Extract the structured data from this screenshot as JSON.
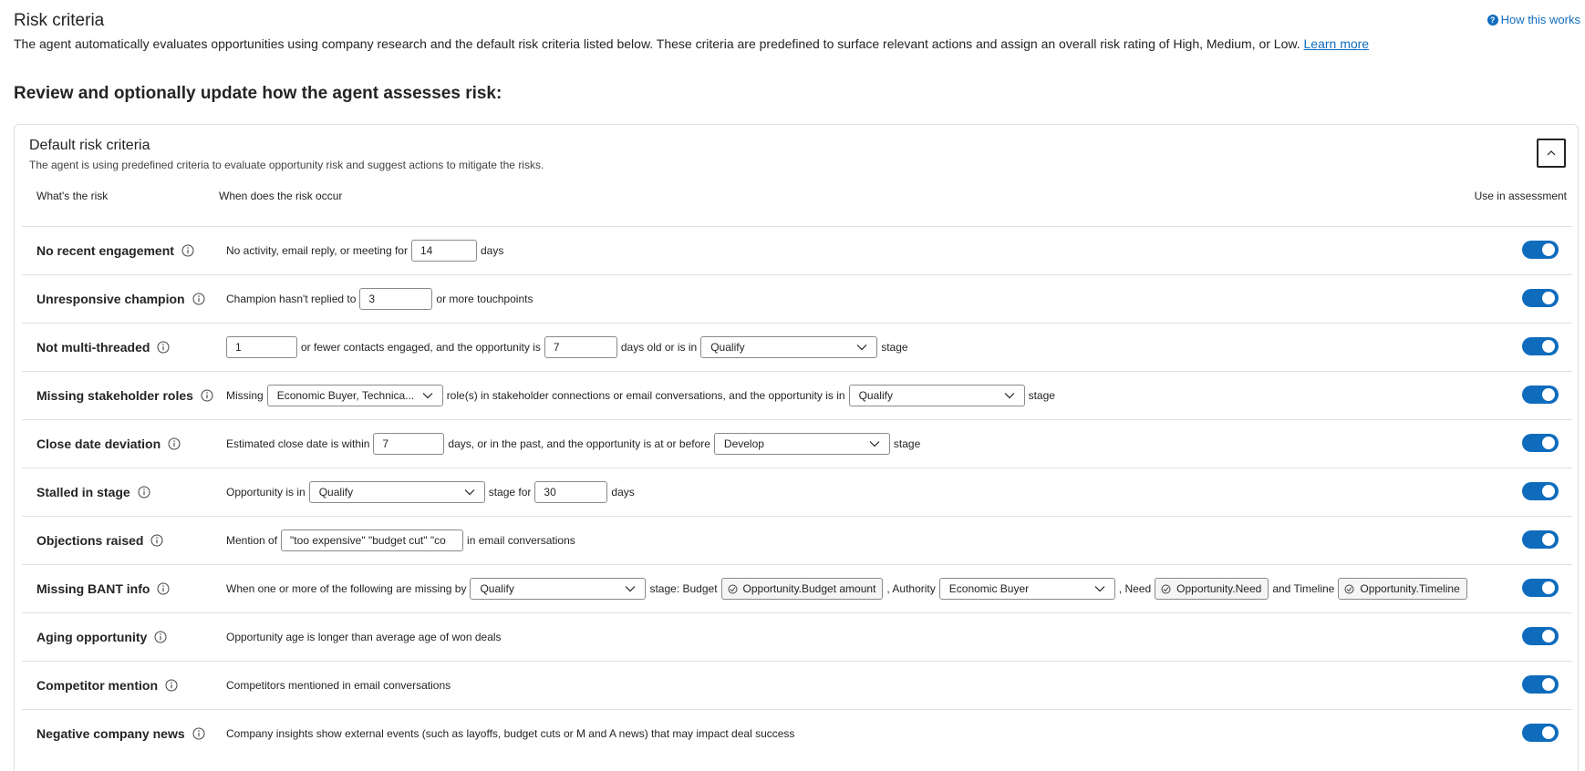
{
  "header": {
    "title": "Risk criteria",
    "help_link": "How this works",
    "intro_text": "The agent automatically evaluates opportunities using company research and the default risk criteria listed below. These criteria are predefined to surface relevant actions and assign an overall risk rating of High, Medium, or Low.",
    "learn_more": "Learn more",
    "review_heading": "Review and optionally update how the agent assesses risk:"
  },
  "card": {
    "title": "Default risk criteria",
    "subtitle": "The agent is using predefined criteria to evaluate opportunity risk and suggest actions to mitigate the risks.",
    "columns": {
      "risk": "What's the risk",
      "when": "When does the risk occur",
      "use": "Use in assessment"
    }
  },
  "rows": {
    "no_recent_engagement": {
      "name": "No recent engagement",
      "t1": "No activity, email reply, or meeting for",
      "days_value": "14",
      "t2": "days",
      "enabled": true
    },
    "unresponsive_champion": {
      "name": "Unresponsive champion",
      "t1": "Champion hasn't replied to",
      "touchpoints_value": "3",
      "t2": "or more touchpoints",
      "enabled": true
    },
    "not_multi_threaded": {
      "name": "Not multi-threaded",
      "contacts_value": "1",
      "t1": "or fewer contacts engaged, and the opportunity is",
      "days_value": "7",
      "t2": "days old or is in",
      "stage_value": "Qualify",
      "t3": "stage",
      "enabled": true
    },
    "missing_stakeholder_roles": {
      "name": "Missing stakeholder roles",
      "t1": "Missing",
      "roles_value": "Economic Buyer, Technica...",
      "t2": "role(s) in stakeholder connections or email conversations, and the opportunity is in",
      "stage_value": "Qualify",
      "t3": "stage",
      "enabled": true
    },
    "close_date_deviation": {
      "name": "Close date deviation",
      "t1": "Estimated close date is within",
      "days_value": "7",
      "t2": "days, or in the past, and the opportunity is at or before",
      "stage_value": "Develop",
      "t3": "stage",
      "enabled": true
    },
    "stalled_in_stage": {
      "name": "Stalled in stage",
      "t1": "Opportunity is in",
      "stage_value": "Qualify",
      "t2": "stage for",
      "days_value": "30",
      "t3": "days",
      "enabled": true
    },
    "objections_raised": {
      "name": "Objections raised",
      "t1": "Mention of",
      "keywords_value": "\"too expensive\" \"budget cut\" \"co",
      "t2": "in email conversations",
      "enabled": true
    },
    "missing_bant_info": {
      "name": "Missing BANT info",
      "t1": "When one or more of the following are missing by",
      "stage_value": "Qualify",
      "t2": "stage: Budget",
      "budget_chip": "Opportunity.Budget amount",
      "t3": ", Authority",
      "authority_value": "Economic Buyer",
      "t4": ", Need",
      "need_chip": "Opportunity.Need",
      "t5": "and Timeline",
      "timeline_chip": "Opportunity.Timeline",
      "enabled": true
    },
    "aging_opportunity": {
      "name": "Aging opportunity",
      "t1": "Opportunity age is longer than average age of won deals",
      "enabled": true
    },
    "competitor_mention": {
      "name": "Competitor mention",
      "t1": "Competitors mentioned in email conversations",
      "enabled": true
    },
    "negative_company_news": {
      "name": "Negative company news",
      "t1": "Company insights show external events (such as layoffs, budget cuts or M and A news) that may impact deal success",
      "enabled": true
    }
  },
  "icons": {
    "info": "info-circle-icon",
    "chevron": "chevron-down-icon",
    "collapse": "chevron-up-icon",
    "field_ref": "field-reference-icon",
    "help": "question-circle-icon"
  },
  "colors": {
    "accent": "#0f6cbd",
    "text": "#242424",
    "border": "#e0e0e0"
  }
}
